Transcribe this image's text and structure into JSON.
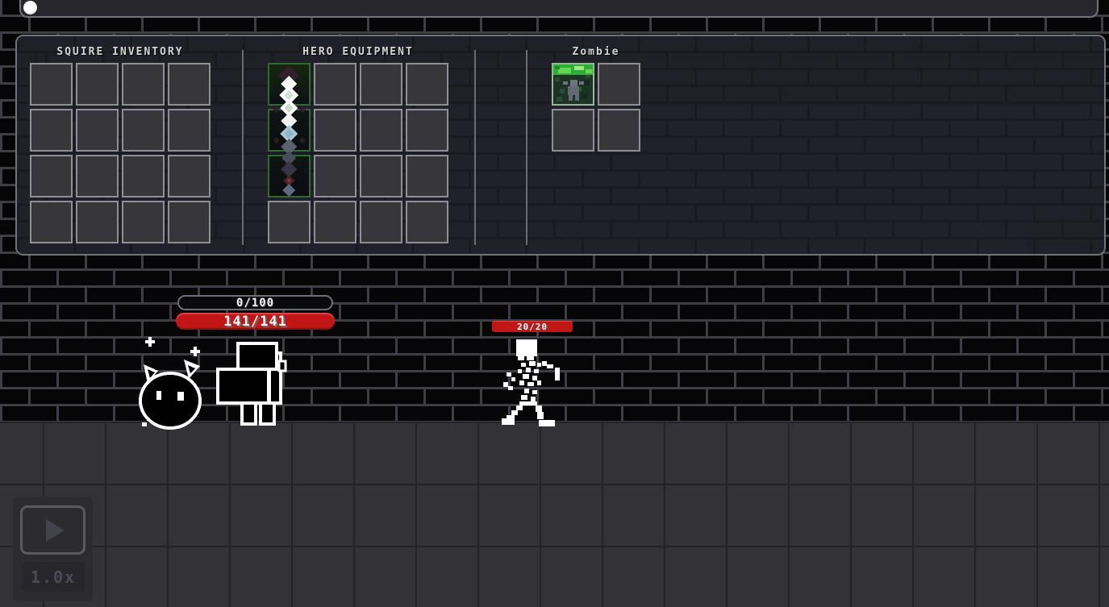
{
  "window": {
    "top_bar_icon": "white-orb"
  },
  "panel": {
    "sections": [
      {
        "id": "squire",
        "title": "SQUIRE INVENTORY",
        "rows": 4,
        "cols": 4,
        "slot_kind": "inventory-slot"
      },
      {
        "id": "hero",
        "title": "HERO EQUIPMENT",
        "rows": 4,
        "cols": 4,
        "slot_kind": "equipment-slot",
        "equipped_item": {
          "name": "sword",
          "cells": [
            0,
            4,
            8
          ]
        }
      },
      {
        "id": "zombie",
        "title": "Zombie",
        "rows": 2,
        "cols": 2,
        "slot_kind": "zombie-slot",
        "item": {
          "name": "zombie-card",
          "cell": 0
        }
      }
    ]
  },
  "scene": {
    "hero": {
      "sprite": "knight",
      "xp_label": "0/100",
      "hp_label": "141/141"
    },
    "squire": {
      "sprite": "horned-blob"
    },
    "enemy": {
      "name": "Zombie",
      "sprite": "skeleton",
      "hp_label": "20/20"
    }
  },
  "controls": {
    "play_icon": "play-triangle",
    "speed_label": "1.0x"
  },
  "colors": {
    "hp_red": "#c01616",
    "xp_bar_bg": "#0a0a0c",
    "slot_border": "#8f8f94",
    "equip_highlight_green": "#2e6b30",
    "zombie_card_green": "#2fae37",
    "panel_bg": "#1e1f25",
    "mortar": "#3e3e44",
    "brick": "#060607",
    "floor": "#323237"
  }
}
